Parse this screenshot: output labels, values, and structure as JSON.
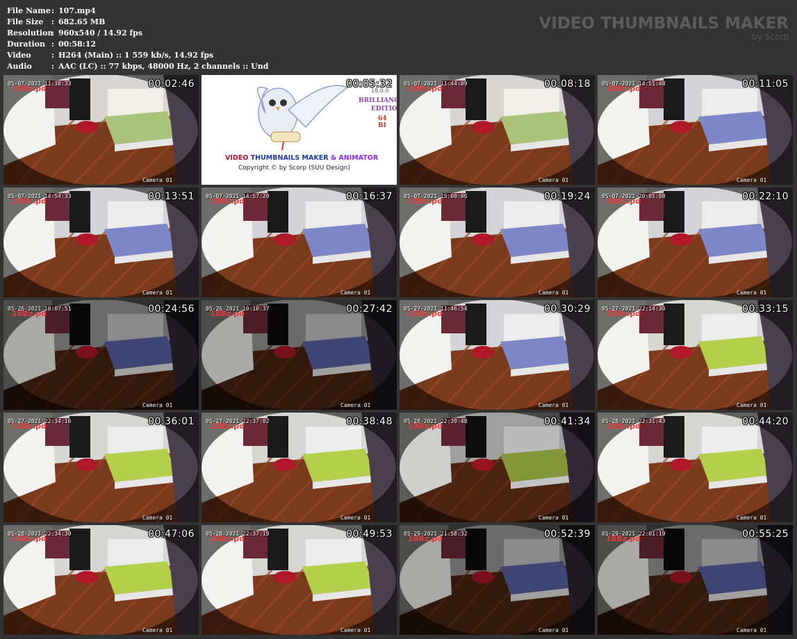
{
  "info": [
    {
      "label": "File Name",
      "value": "107.mp4"
    },
    {
      "label": "File Size",
      "value": "682.65 MB"
    },
    {
      "label": "Resolution",
      "value": "960x540 / 14.92 fps"
    },
    {
      "label": "Duration",
      "value": "00:58:12"
    },
    {
      "label": "Video",
      "value": "H264 (Main) :: 1 559 kb/s, 14.92 fps"
    },
    {
      "label": "Audio",
      "value": "AAC (LC) :: 77 kbps, 48000 Hz, 2 channels :: Und"
    }
  ],
  "separator": ":",
  "brand": {
    "title": "VIDEO THUMBNAILS MAKER",
    "subtitle": "by Scorp"
  },
  "promo": {
    "title_a": "VIDEO ",
    "title_b": "THUMBNAILS MAKER",
    "title_c": " & ANIMATOR",
    "copyright": "Copyright © by Scorp (SUU Design)",
    "version": "18.0.0",
    "edition_1": "BRILLIANC",
    "edition_2": "EDITIO",
    "edition_3": "64 BI"
  },
  "camera_label": "Camera 01",
  "watermark": "18Bz.pd",
  "thumbnails": [
    {
      "time": "00:02:46",
      "osd": "05-07-2021 11:38:33",
      "scene": "bright"
    },
    {
      "time": "00:05:32",
      "osd": "",
      "scene": "promo"
    },
    {
      "time": "00:08:18",
      "osd": "05-07-2021 11:44:09",
      "scene": "bright"
    },
    {
      "time": "00:11:05",
      "osd": "05-07-2021 14:51:48",
      "scene": "blue"
    },
    {
      "time": "00:13:51",
      "osd": "05-07-2021 14:54:33",
      "scene": "blue"
    },
    {
      "time": "00:16:37",
      "osd": "05-07-2021 14:57:20",
      "scene": "blue"
    },
    {
      "time": "00:19:24",
      "osd": "05-07-2021 15:00:06",
      "scene": "blue"
    },
    {
      "time": "00:22:10",
      "osd": "05-07-2021 20:05:08",
      "scene": "blue"
    },
    {
      "time": "00:24:56",
      "osd": "05-26-2021 10:07:51",
      "scene": "dark"
    },
    {
      "time": "00:27:42",
      "osd": "05-26-2021 10:10:37",
      "scene": "dark"
    },
    {
      "time": "00:30:29",
      "osd": "05-27-2021 11:46:54",
      "scene": "blue"
    },
    {
      "time": "00:33:15",
      "osd": "05-27-2021 22:14:30",
      "scene": "green"
    },
    {
      "time": "00:36:01",
      "osd": "05-27-2021 22:34:16",
      "scene": "green"
    },
    {
      "time": "00:38:48",
      "osd": "05-27-2021 22:37:02",
      "scene": "green"
    },
    {
      "time": "00:41:34",
      "osd": "05-28-2021 22:39:48",
      "scene": "darkgreen"
    },
    {
      "time": "00:44:20",
      "osd": "05-28-2021 22:31:43",
      "scene": "green"
    },
    {
      "time": "00:47:06",
      "osd": "05-28-2021 22:34:30",
      "scene": "green"
    },
    {
      "time": "00:49:53",
      "osd": "05-28-2021 22:37:19",
      "scene": "green"
    },
    {
      "time": "00:52:39",
      "osd": "05-29-2021 21:58:32",
      "scene": "dark"
    },
    {
      "time": "00:55:25",
      "osd": "05-29-2021 22:01:19",
      "scene": "dark"
    }
  ],
  "colors": {
    "background": "#333333",
    "text": "#ffffff",
    "brand": "#5c5c5c",
    "timestamp_outline": "#000000"
  }
}
